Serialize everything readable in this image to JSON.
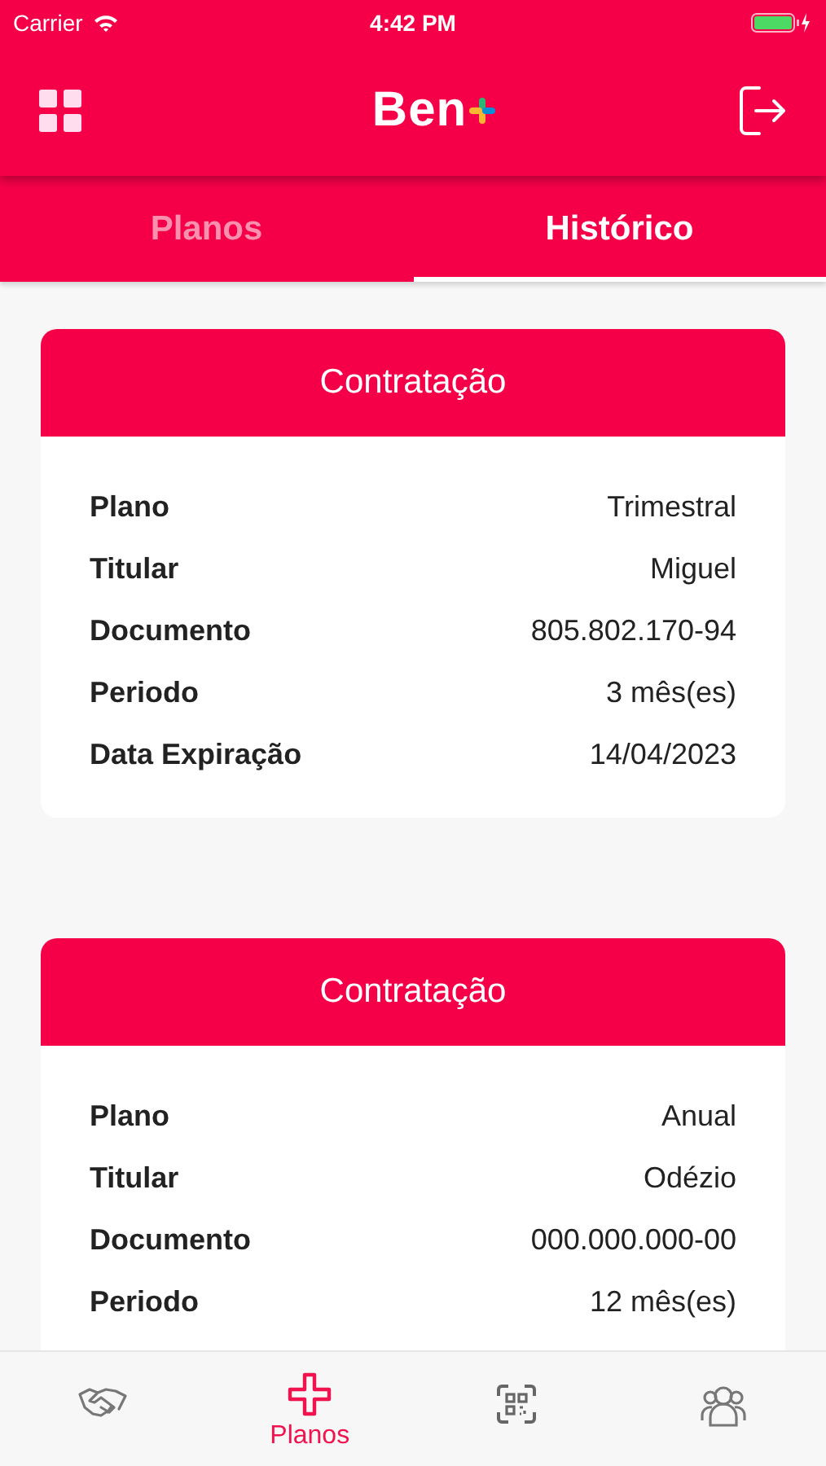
{
  "status_bar": {
    "carrier": "Carrier",
    "time": "4:42 PM"
  },
  "header": {
    "logo": "Ben"
  },
  "tabs": [
    {
      "label": "Planos",
      "selected": false
    },
    {
      "label": "Histórico",
      "selected": true
    }
  ],
  "cards": [
    {
      "title": "Contratação",
      "rows": [
        {
          "label": "Plano",
          "value": "Trimestral"
        },
        {
          "label": "Titular",
          "value": "Miguel"
        },
        {
          "label": "Documento",
          "value": "805.802.170-94"
        },
        {
          "label": "Periodo",
          "value": "3 mês(es)"
        },
        {
          "label": "Data Expiração",
          "value": "14/04/2023"
        }
      ]
    },
    {
      "title": "Contratação",
      "rows": [
        {
          "label": "Plano",
          "value": "Anual"
        },
        {
          "label": "Titular",
          "value": "Odézio"
        },
        {
          "label": "Documento",
          "value": "000.000.000-00"
        },
        {
          "label": "Periodo",
          "value": "12 mês(es)"
        }
      ]
    }
  ],
  "bottom_nav": [
    {
      "kind": "handshake",
      "selected": false
    },
    {
      "kind": "plus",
      "label": "Planos",
      "selected": true
    },
    {
      "kind": "qrcode",
      "selected": false
    },
    {
      "kind": "people",
      "selected": false
    }
  ]
}
